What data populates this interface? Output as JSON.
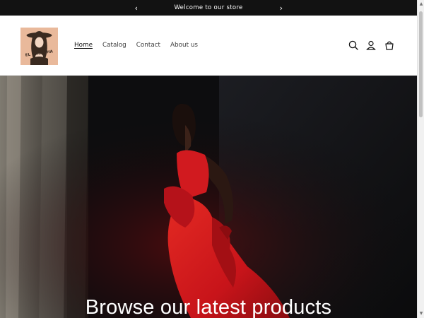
{
  "announcement": {
    "text": "Welcome to our store",
    "prev_icon": "chevron-left-icon",
    "next_icon": "chevron-right-icon"
  },
  "header": {
    "logo_text": "EL SHEEKHA",
    "nav": [
      {
        "label": "Home",
        "active": true
      },
      {
        "label": "Catalog",
        "active": false
      },
      {
        "label": "Contact",
        "active": false
      },
      {
        "label": "About us",
        "active": false
      }
    ],
    "icons": [
      "search-icon",
      "account-icon",
      "cart-icon"
    ]
  },
  "hero": {
    "title": "Browse our latest products"
  },
  "colors": {
    "announcement_bg": "#121212",
    "text_dark": "#121212",
    "logo_bg": "#e9b99b",
    "dress_red": "#c8141a"
  }
}
